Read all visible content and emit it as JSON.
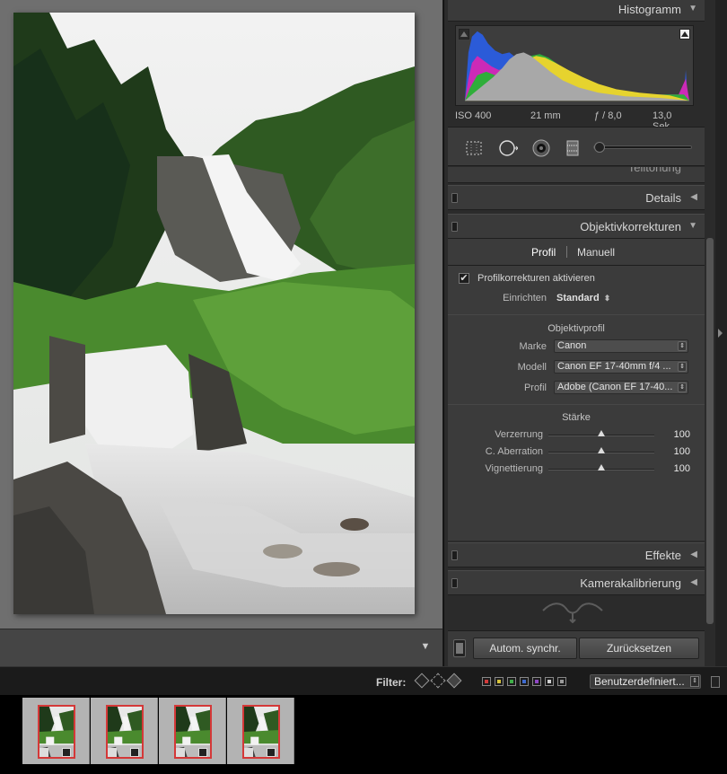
{
  "histogram": {
    "title": "Histogramm",
    "exif": {
      "iso": "ISO 400",
      "focal": "21 mm",
      "aperture": "ƒ / 8,0",
      "shutter": "13,0 Sek."
    }
  },
  "panels": {
    "partial_title": "Teiltonung",
    "details_title": "Details",
    "lens_title": "Objektivkorrekturen",
    "effects_title": "Effekte",
    "calibration_title": "Kamerakalibrierung"
  },
  "lens": {
    "tabs": {
      "profile": "Profil",
      "manual": "Manuell"
    },
    "enable_label": "Profilkorrekturen aktivieren",
    "enable_checked": "✔",
    "setup_label": "Einrichten",
    "setup_value": "Standard",
    "profile_section": "Objektivprofil",
    "make_label": "Marke",
    "make_value": "Canon",
    "model_label": "Modell",
    "model_value": "Canon EF 17-40mm f/4 ...",
    "profile_label": "Profil",
    "profile_value": "Adobe (Canon EF 17-40...",
    "amount_section": "Stärke",
    "sliders": [
      {
        "label": "Verzerrung",
        "value": "100",
        "level": 0.5
      },
      {
        "label": "C. Aberration",
        "value": "100",
        "level": 0.5
      },
      {
        "label": "Vignettierung",
        "value": "100",
        "level": 0.5
      }
    ]
  },
  "bottom_buttons": {
    "sync": "Autom. synchr.",
    "reset": "Zurücksetzen"
  },
  "filter": {
    "label": "Filter:",
    "preset": "Benutzerdefiniert...",
    "colors": [
      "#d23a3a",
      "#d6c23a",
      "#3fae48",
      "#3f6bd0",
      "#8f46c4",
      "#cfcfcf",
      "#9a9a9a"
    ]
  },
  "filmstrip": {
    "count": 4
  },
  "icons": {
    "panel_collapse": "triangle-down-icon",
    "panel_expand": "triangle-left-icon",
    "image_menu": "triangle-down-icon"
  }
}
